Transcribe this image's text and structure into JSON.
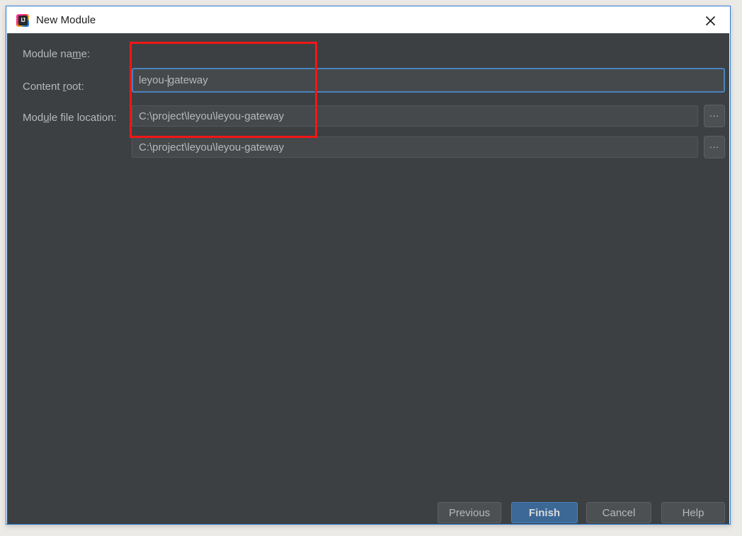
{
  "window": {
    "title": "New Module",
    "app_icon": "intellij-idea-icon",
    "app_icon_text": "IJ",
    "close_icon": "close-icon"
  },
  "form": {
    "fields": [
      {
        "id": "module-name",
        "label_pre": "Module na",
        "label_mnemonic": "m",
        "label_post": "e:",
        "value_pre": "leyou-",
        "value_post": "gateway",
        "value": "leyou-gateway",
        "has_browse": false,
        "focused": true
      },
      {
        "id": "content-root",
        "label_pre": "Content ",
        "label_mnemonic": "r",
        "label_post": "oot:",
        "value": "C:\\project\\leyou\\leyou-gateway",
        "has_browse": true,
        "browse_label": "...",
        "focused": false
      },
      {
        "id": "module-file-location",
        "label_pre": "Mod",
        "label_mnemonic": "u",
        "label_post": "le file location:",
        "value": "C:\\project\\leyou\\leyou-gateway",
        "has_browse": true,
        "browse_label": "...",
        "focused": false
      }
    ]
  },
  "buttons": {
    "previous": "Previous",
    "finish": "Finish",
    "cancel": "Cancel",
    "help": "Help"
  },
  "annotation": {
    "type": "highlight-rectangle",
    "color": "#f21616"
  },
  "colors": {
    "content_background": "#3c4043",
    "field_background": "#45494c",
    "focus_border": "#4a82bd",
    "default_button": "#3c6896",
    "text": "#b6b9bb",
    "titlebar_background": "#ffffff",
    "dialog_border": "#2d7dd2",
    "annotation": "#f21616"
  }
}
